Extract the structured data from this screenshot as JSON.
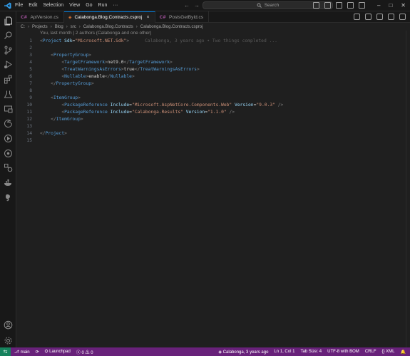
{
  "menu": [
    "File",
    "Edit",
    "Selection",
    "View",
    "Go",
    "Run",
    "···"
  ],
  "search": {
    "label": "Search"
  },
  "tabs": [
    {
      "icon": "C#",
      "label": "ApiVersion.cs",
      "active": false
    },
    {
      "icon": "◈",
      "label": "Calabonga.Blog.Contracts.csproj",
      "active": true,
      "close": "×"
    },
    {
      "icon": "C#",
      "label": "PostsGetById.cs",
      "active": false
    }
  ],
  "breadcrumb": [
    "C:",
    "Projects",
    "Blog",
    "src",
    "Calabonga.Blog.Contracts",
    "Calabonga.Blog.Contracts.csproj"
  ],
  "codelens": "You, last month | 2 authors (Calabonga and one other)",
  "blame": "Calabonga, 3 years ago • Two things completed ...",
  "code_lines": [
    {
      "n": "1",
      "parts": [
        [
          "<",
          "#808080"
        ],
        [
          "Project",
          "#569cd6"
        ],
        [
          " ",
          "#d4d4d4"
        ],
        [
          "Sdk",
          "#9cdcfe"
        ],
        [
          "=",
          "#d4d4d4"
        ],
        [
          "\"Microsoft.NET.Sdk\"",
          "#ce9178"
        ],
        [
          ">",
          "#808080"
        ]
      ]
    },
    {
      "n": "2",
      "parts": []
    },
    {
      "n": "3",
      "parts": [
        [
          "    <",
          "#808080"
        ],
        [
          "PropertyGroup",
          "#569cd6"
        ],
        [
          ">",
          "#808080"
        ]
      ]
    },
    {
      "n": "4",
      "parts": [
        [
          "        <",
          "#808080"
        ],
        [
          "TargetFramework",
          "#569cd6"
        ],
        [
          ">",
          "#808080"
        ],
        [
          "net9.0",
          "#d4d4d4"
        ],
        [
          "</",
          "#808080"
        ],
        [
          "TargetFramework",
          "#569cd6"
        ],
        [
          ">",
          "#808080"
        ]
      ]
    },
    {
      "n": "5",
      "parts": [
        [
          "        <",
          "#808080"
        ],
        [
          "TreatWarningsAsErrors",
          "#569cd6"
        ],
        [
          ">",
          "#808080"
        ],
        [
          "true",
          "#d4d4d4"
        ],
        [
          "</",
          "#808080"
        ],
        [
          "TreatWarningsAsErrors",
          "#569cd6"
        ],
        [
          ">",
          "#808080"
        ]
      ]
    },
    {
      "n": "6",
      "parts": [
        [
          "        <",
          "#808080"
        ],
        [
          "Nullable",
          "#569cd6"
        ],
        [
          ">",
          "#808080"
        ],
        [
          "enable",
          "#d4d4d4"
        ],
        [
          "</",
          "#808080"
        ],
        [
          "Nullable",
          "#569cd6"
        ],
        [
          ">",
          "#808080"
        ]
      ]
    },
    {
      "n": "7",
      "parts": [
        [
          "    </",
          "#808080"
        ],
        [
          "PropertyGroup",
          "#569cd6"
        ],
        [
          ">",
          "#808080"
        ]
      ]
    },
    {
      "n": "8",
      "parts": []
    },
    {
      "n": "9",
      "parts": [
        [
          "    <",
          "#808080"
        ],
        [
          "ItemGroup",
          "#569cd6"
        ],
        [
          ">",
          "#808080"
        ]
      ]
    },
    {
      "n": "10",
      "parts": [
        [
          "        <",
          "#808080"
        ],
        [
          "PackageReference",
          "#569cd6"
        ],
        [
          " ",
          "#d4d4d4"
        ],
        [
          "Include",
          "#9cdcfe"
        ],
        [
          "=",
          "#d4d4d4"
        ],
        [
          "\"Microsoft.AspNetCore.Components.Web\"",
          "#ce9178"
        ],
        [
          " ",
          "#d4d4d4"
        ],
        [
          "Version",
          "#9cdcfe"
        ],
        [
          "=",
          "#d4d4d4"
        ],
        [
          "\"9.0.3\"",
          "#ce9178"
        ],
        [
          " />",
          "#808080"
        ]
      ]
    },
    {
      "n": "11",
      "parts": [
        [
          "        <",
          "#808080"
        ],
        [
          "PackageReference",
          "#569cd6"
        ],
        [
          " ",
          "#d4d4d4"
        ],
        [
          "Include",
          "#9cdcfe"
        ],
        [
          "=",
          "#d4d4d4"
        ],
        [
          "\"Calabonga.Results\"",
          "#ce9178"
        ],
        [
          " ",
          "#d4d4d4"
        ],
        [
          "Version",
          "#9cdcfe"
        ],
        [
          "=",
          "#d4d4d4"
        ],
        [
          "\"1.1.0\"",
          "#ce9178"
        ],
        [
          " />",
          "#808080"
        ]
      ]
    },
    {
      "n": "12",
      "parts": [
        [
          "    </",
          "#808080"
        ],
        [
          "ItemGroup",
          "#569cd6"
        ],
        [
          ">",
          "#808080"
        ]
      ]
    },
    {
      "n": "13",
      "parts": []
    },
    {
      "n": "14",
      "parts": [
        [
          "</",
          "#808080"
        ],
        [
          "Project",
          "#569cd6"
        ],
        [
          ">",
          "#808080"
        ]
      ]
    },
    {
      "n": "15",
      "parts": []
    }
  ],
  "status": {
    "remote_icon": "⇆",
    "branch": "main",
    "sync": "⟳",
    "launchpad": "Launchpad",
    "errors": "0",
    "warnings": "0",
    "blame": "Calabonga, 3 years ago",
    "position": "Ln 1, Col 1",
    "tab_size": "Tab Size: 4",
    "encoding": "UTF-8 with BOM",
    "eol": "CRLF",
    "language": "XML"
  },
  "colors": {
    "accent": "#0078d4",
    "statusbar": "#68217a",
    "remote": "#16825d"
  }
}
